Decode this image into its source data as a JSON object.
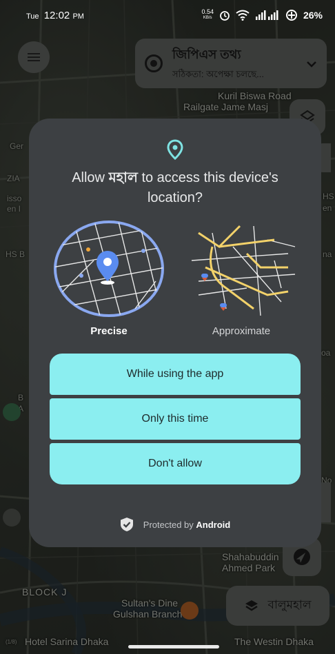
{
  "status_bar": {
    "day": "Tue",
    "time": "12:02",
    "ampm": "PM",
    "net_speed_value": "0.54",
    "net_speed_unit": "KB/s",
    "battery": "26%"
  },
  "gps_card": {
    "title": "জিপিএস তথ্য",
    "subtitle": "সঠিকতা: অপেক্ষা চলছে..."
  },
  "map_labels": {
    "road1": "Kuril Biswa Road",
    "road2": "Railgate Jame Masj",
    "park1": "Shahabuddin",
    "park2": "Ahmed Park",
    "block": "BLOCK J",
    "diner1": "Sultan's Dine",
    "diner2": "Gulshan Branch",
    "hotel1": "Hotel Sarina Dhaka",
    "hotel2": "The Westin Dhaka",
    "edge1": "Ger",
    "edge2": "ZIA",
    "edge3": "isso",
    "edge4": "en I",
    "edge5": "HS B",
    "edge6": "HS",
    "edge7": "en",
    "edge8": "na",
    "edge9": "roa",
    "edge10": "B",
    "edge11": "A",
    "edge12": "No",
    "badge": "(1/8)"
  },
  "area_button": {
    "label": "বালুমহাল"
  },
  "dialog": {
    "title_prefix": "Allow ",
    "app_name": "মহাল",
    "title_suffix": " to access this device's location?",
    "precise_label": "Precise",
    "approx_label": "Approximate",
    "btn_while_using": "While using the app",
    "btn_only_this_time": "Only this time",
    "btn_dont_allow": "Don't allow",
    "protected_prefix": "Protected by ",
    "protected_brand": "Android"
  },
  "colors": {
    "accent": "#8beef0",
    "dialog_bg": "#3d4043",
    "pin_teal": "#7fe3e3",
    "map_blue": "#8aa8f0"
  },
  "icons": {
    "menu": "menu-icon",
    "gps": "gps-target-icon",
    "chevron": "chevron-down-icon",
    "layers": "layers-icon",
    "compass": "compass-icon",
    "location_pin": "location-pin-icon",
    "shield": "shield-check-icon"
  }
}
